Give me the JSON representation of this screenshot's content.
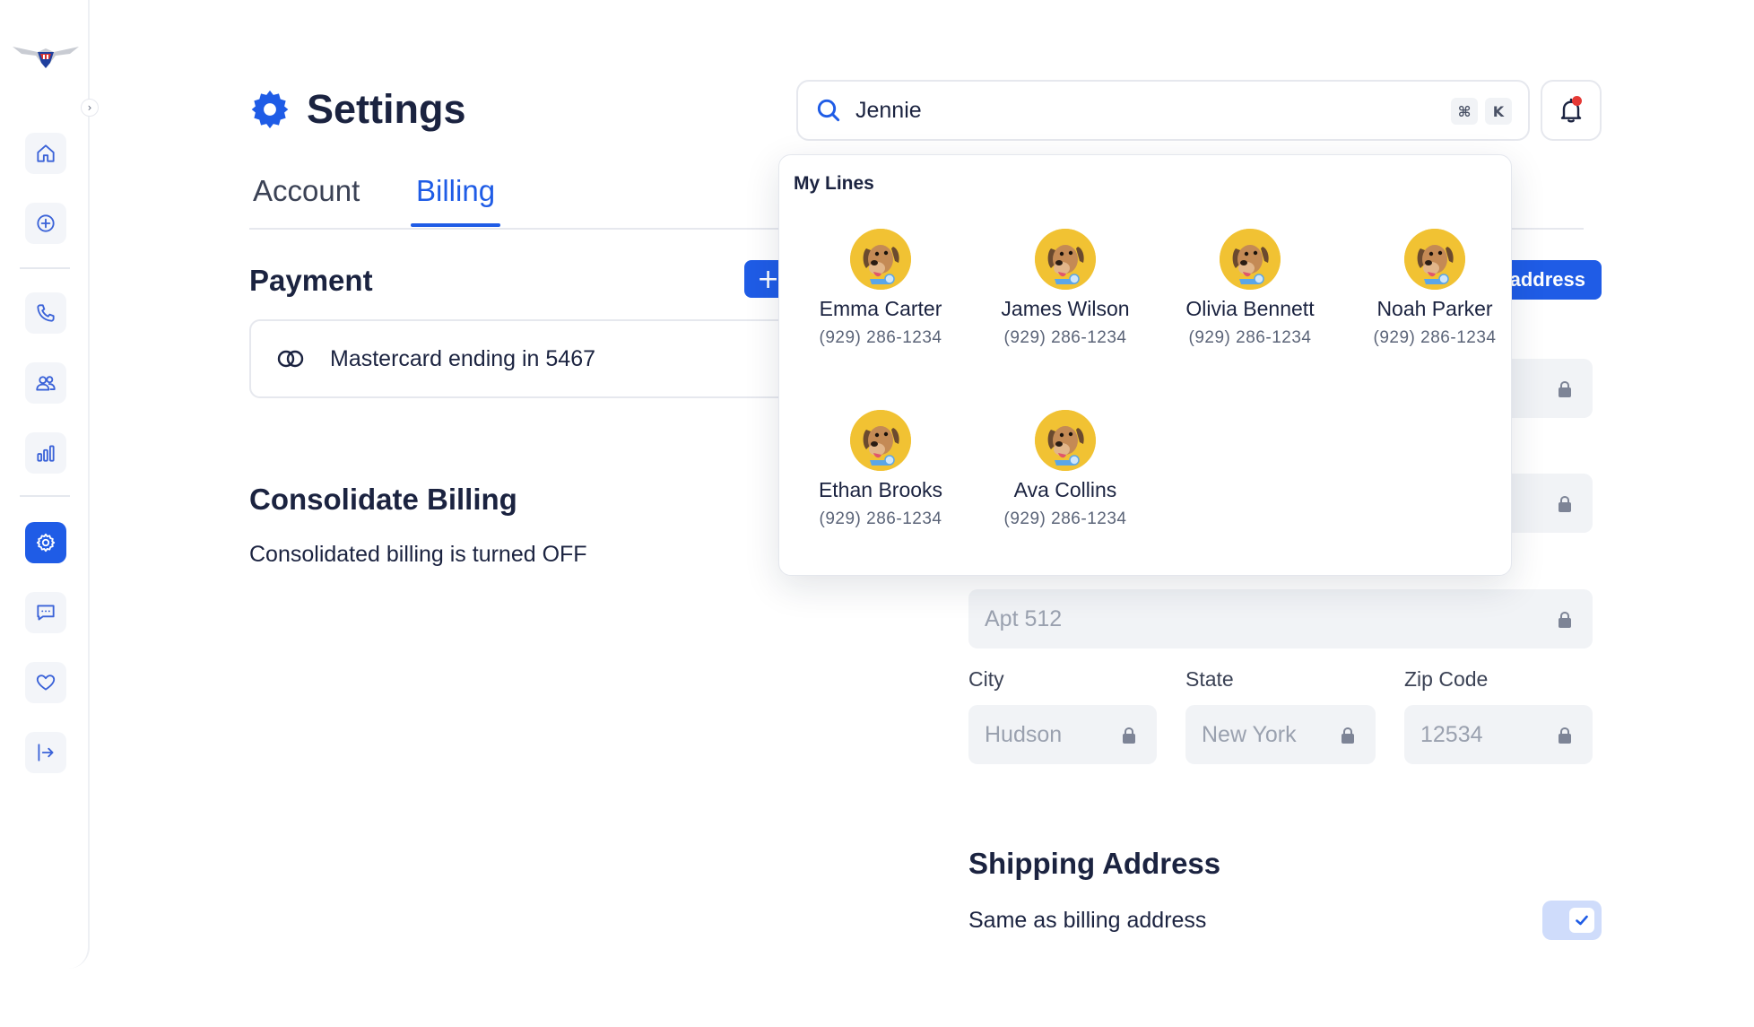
{
  "page": {
    "title": "Settings"
  },
  "search": {
    "value": "Jennie",
    "shortcut_mod": "⌘",
    "shortcut_key": "K"
  },
  "tabs": [
    {
      "label": "Account"
    },
    {
      "label": "Billing"
    }
  ],
  "payment": {
    "title": "Payment",
    "add_label": "+",
    "card_text": "Mastercard ending in 5467"
  },
  "consolidate": {
    "title": "Consolidate Billing",
    "status": "Consolidated billing is turned OFF"
  },
  "billing_address": {
    "add_button_label": "address",
    "apt_value": "Apt 512",
    "city_label": "City",
    "city_value": "Hudson",
    "state_label": "State",
    "state_value": "New York",
    "zip_label": "Zip Code",
    "zip_value": "12534"
  },
  "shipping": {
    "title": "Shipping Address",
    "same_as_billing_label": "Same as billing address",
    "same_as_billing_checked": true
  },
  "dropdown": {
    "title": "My Lines",
    "lines": [
      {
        "name": "Emma Carter",
        "phone": "(929) 286-1234"
      },
      {
        "name": "James Wilson",
        "phone": "(929) 286-1234"
      },
      {
        "name": "Olivia Bennett",
        "phone": "(929) 286-1234"
      },
      {
        "name": "Noah Parker",
        "phone": "(929) 286-1234"
      },
      {
        "name": "Ethan Brooks",
        "phone": "(929) 286-1234"
      },
      {
        "name": "Ava Collins",
        "phone": "(929) 286-1234"
      }
    ]
  },
  "colors": {
    "accent": "#1f5ce6",
    "text": "#1b2340",
    "field_bg": "#f1f3f6",
    "avatar_bg": "#f1c233",
    "notification_dot": "#e53935"
  },
  "icons": {
    "sidebar": [
      "home-icon",
      "add-circle-icon",
      "phone-icon",
      "users-icon",
      "bar-chart-icon",
      "gear-icon",
      "chat-icon",
      "heart-icon",
      "logout-icon"
    ]
  }
}
